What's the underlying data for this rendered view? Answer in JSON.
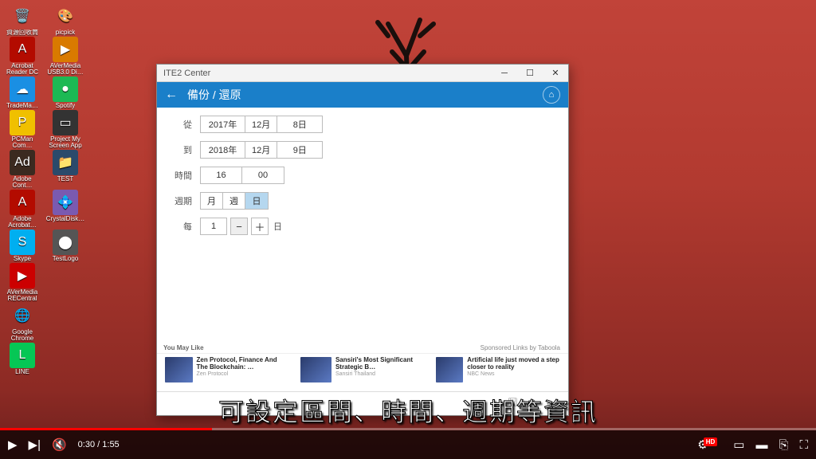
{
  "desktop_icons": [
    [
      {
        "label": "資源回收筒",
        "color": "transparent",
        "glyph": "🗑️"
      },
      {
        "label": "picpick",
        "color": "transparent",
        "glyph": "🎨"
      }
    ],
    [
      {
        "label": "Acrobat Reader DC",
        "color": "#b30b00",
        "glyph": "A"
      },
      {
        "label": "AVerMedia USB3.0 Di…",
        "color": "#d97a00",
        "glyph": "▶"
      }
    ],
    [
      {
        "label": "TradeMa…",
        "color": "#1a8fe3",
        "glyph": "☁"
      },
      {
        "label": "Spotify",
        "color": "#1db954",
        "glyph": "●"
      }
    ],
    [
      {
        "label": "PCMan Com…",
        "color": "#f0c000",
        "glyph": "P"
      },
      {
        "label": "Project My Screen App",
        "color": "#333",
        "glyph": "▭"
      }
    ],
    [
      {
        "label": "Adobe Cont…",
        "color": "#3b2a20",
        "glyph": "Ad"
      },
      {
        "label": "TEST",
        "color": "#2b4a6b",
        "glyph": "📁"
      }
    ],
    [
      {
        "label": "Adobe Acrobat…",
        "color": "#b30b00",
        "glyph": "A"
      },
      {
        "label": "CrystalDisk…",
        "color": "#7a5ab0",
        "glyph": "💠"
      }
    ],
    [
      {
        "label": "Skype",
        "color": "#00aff0",
        "glyph": "S"
      },
      {
        "label": "TestLogo",
        "color": "#555",
        "glyph": "⬤"
      }
    ],
    [
      {
        "label": "AVerMedia RECentral",
        "color": "#c00",
        "glyph": "▶"
      }
    ],
    [
      {
        "label": "Google Chrome",
        "color": "transparent",
        "glyph": "🌐"
      }
    ],
    [
      {
        "label": "LINE",
        "color": "#06c755",
        "glyph": "L"
      }
    ]
  ],
  "window": {
    "title": "ITE2 Center",
    "header": "備份 / 還原",
    "labels": {
      "from": "從",
      "to": "到",
      "time": "時間",
      "cycle": "週期",
      "every": "每",
      "unit": "日"
    },
    "from": {
      "year": "2017年",
      "month": "12月",
      "day": "8日"
    },
    "to": {
      "year": "2018年",
      "month": "12月",
      "day": "9日"
    },
    "time": {
      "hour": "16",
      "minute": "00"
    },
    "cycle_tabs": {
      "month": "月",
      "week": "週",
      "day": "日",
      "active": "day"
    },
    "every_value": "1",
    "minus": "−",
    "plus": "＋",
    "ads_header": "You May Like",
    "sponsored": "Sponsored Links by Taboola",
    "ads": [
      {
        "title": "Zen Protocol, Finance And The Blockchain: …",
        "source": "Zen Protocol"
      },
      {
        "title": "Sansiri's Most Significant Strategic B…",
        "source": "Sansiri Thailand"
      },
      {
        "title": "Artificial life just moved a step closer to reality",
        "source": "NBC News"
      }
    ]
  },
  "subtitle": "可設定區間、時間、週期等資訊",
  "video": {
    "current": "0:30",
    "total": "1:55"
  }
}
